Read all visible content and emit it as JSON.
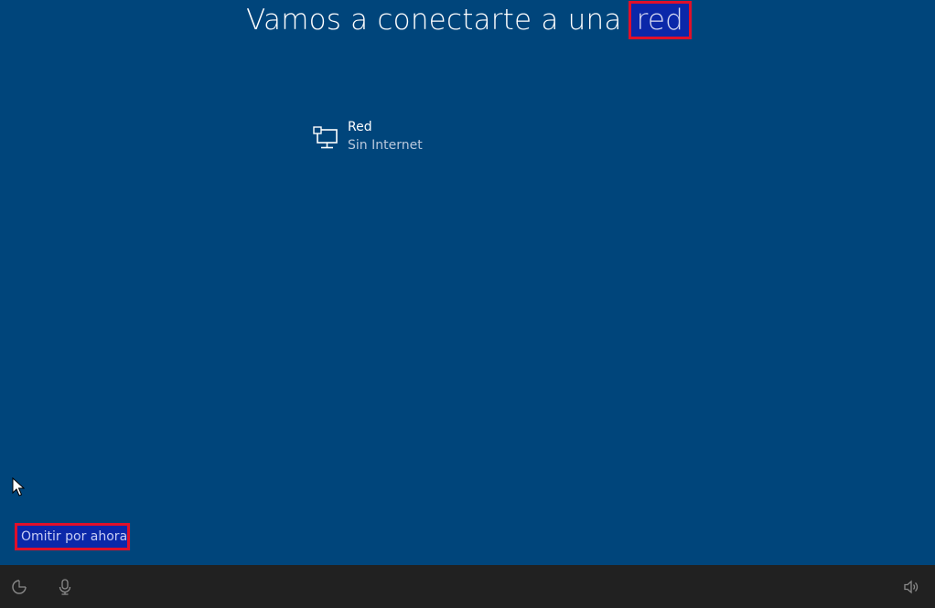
{
  "header": {
    "title_prefix": "Vamos a conectarte a una ",
    "title_highlight": "red"
  },
  "networks": [
    {
      "name": "Red",
      "status": "Sin Internet",
      "icon": "wired-network-icon"
    }
  ],
  "footer": {
    "skip_label": "Omitir por ahora"
  },
  "taskbar": {
    "left_icons": [
      "ease-of-access-icon",
      "microphone-icon"
    ],
    "right_icons": [
      "volume-icon"
    ]
  },
  "colors": {
    "background": "#00457b",
    "taskbar": "#212121",
    "highlight_fill": "#0b28a9",
    "highlight_border": "#e0102a",
    "secondary_text": "#b9c8dc"
  }
}
